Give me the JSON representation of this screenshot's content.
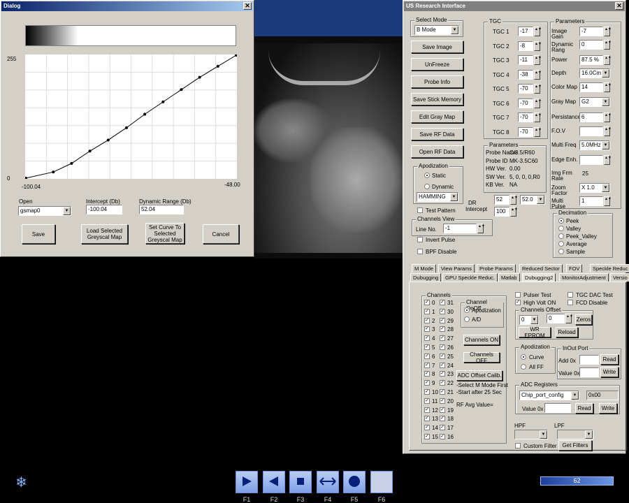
{
  "dialog": {
    "title": "Dialog",
    "close": "✕",
    "y_max": "255",
    "y_min": "0",
    "x_min": "-100.04",
    "x_max": "-48.00",
    "open_label": "Open",
    "open_value": "gsmap0",
    "intercept_label": "Intercept (Db)",
    "intercept_value": "-100.04",
    "range_label": "Dynamic Range (Db)",
    "range_value": "52.04",
    "btn_save": "Save",
    "btn_load": "Load Selected Greyscal Map",
    "btn_set": "Set Curve To Selected Greyscal Map",
    "btn_cancel": "Cancel",
    "curve": [
      [
        0,
        0
      ],
      [
        15,
        5
      ],
      [
        25,
        12
      ],
      [
        35,
        22
      ],
      [
        45,
        31
      ],
      [
        55,
        41
      ],
      [
        65,
        52
      ],
      [
        75,
        62
      ],
      [
        85,
        72
      ],
      [
        95,
        82
      ],
      [
        105,
        91
      ],
      [
        115,
        100
      ]
    ]
  },
  "us": {
    "title": "US Research Interface",
    "close": "✕",
    "select_mode_label": "Select Mode",
    "select_mode_value": "B Mode",
    "buttons": [
      "Save Image",
      "UnFreeze",
      "Probe Info",
      "Save Stick Memory",
      "Edit Gray Map",
      "Save RF Data",
      "Open RF Data"
    ],
    "tgc_label": "TGC",
    "tgc": [
      {
        "l": "TGC 1",
        "v": "-17"
      },
      {
        "l": "TGC 2",
        "v": "-8"
      },
      {
        "l": "TGC 3",
        "v": "-11"
      },
      {
        "l": "TGC 4",
        "v": "-38"
      },
      {
        "l": "TGC 5",
        "v": "-70"
      },
      {
        "l": "TGC 6",
        "v": "-70"
      },
      {
        "l": "TGC 7",
        "v": "-70"
      },
      {
        "l": "TGC 8",
        "v": "-70"
      }
    ],
    "params_label": "Parameters",
    "params": [
      {
        "l": "Image Gain",
        "v": "-7"
      },
      {
        "l": "Dynamic Rang",
        "v": "0"
      },
      {
        "l": "Power",
        "v": "87.5 %"
      },
      {
        "l": "Depth",
        "v": "16.0Cm"
      },
      {
        "l": "Color Map",
        "v": "14"
      },
      {
        "l": "Gray Map",
        "v": "G2"
      },
      {
        "l": "Persistance",
        "v": "6"
      },
      {
        "l": "F.O.V",
        "v": ""
      },
      {
        "l": "Multi Freq",
        "v": "5.0MHz"
      },
      {
        "l": "Edge Enh.",
        "v": ""
      },
      {
        "l": "Img Frm Rate",
        "v": "25"
      },
      {
        "l": "Zoom Factor",
        "v": "X 1.0"
      },
      {
        "l": "Multi Pulse",
        "v": "1"
      }
    ],
    "probe": {
      "label": "Parameters",
      "rows": [
        {
          "l": "Probe Name",
          "v": "C/3.5/R60"
        },
        {
          "l": "Probe ID",
          "v": "MK-3.5C60"
        },
        {
          "l": "HW Ver.",
          "v": "0.00"
        },
        {
          "l": "SW Ver.",
          "v": "5, 0, 0, 0,R0"
        },
        {
          "l": "KB Ver.",
          "v": "NA"
        }
      ]
    },
    "apod": {
      "label": "Apodization",
      "static": "Static",
      "dynamic": "Dynamic",
      "window": "HAMMING"
    },
    "test_pattern": "Test Pattern",
    "dr_label": "DR",
    "dr_value": "52",
    "dr_sel": "52.0",
    "intercept_label": "Intercept",
    "intercept_value": "100",
    "channels_view": {
      "label": "Channels View",
      "line_no": "Line No.",
      "line_val": "-1"
    },
    "invert": "Invert Pulse",
    "bpf": "BPF Disable",
    "decimation": {
      "label": "Decimation",
      "opts": [
        "Peek",
        "Valley",
        "Peek_Valley",
        "Average",
        "Sample"
      ]
    },
    "tabs_row1": [
      "M Mode",
      "View Params",
      "Probe Params",
      "Reduced Sector",
      "FOV",
      "Speckle Reduc"
    ],
    "tabs_row2": [
      "Dubugging",
      "GPU Speckle Reduc.",
      "Matlab",
      "Dubugging2",
      "MonitorAdjustment",
      "Versio"
    ],
    "channels_label": "Channels",
    "ch_left": [
      "0",
      "1",
      "2",
      "3",
      "4",
      "5",
      "6",
      "7",
      "8",
      "9",
      "10",
      "11",
      "12",
      "13",
      "14",
      "15"
    ],
    "ch_right": [
      "31",
      "30",
      "29",
      "28",
      "27",
      "26",
      "25",
      "24",
      "23",
      "22",
      "21",
      "20",
      "19",
      "18",
      "17",
      "16"
    ],
    "onoff": {
      "label": "Channel OnOff",
      "apod": "Apodization",
      "ad": "A/D"
    },
    "btn_on": "Channels ON",
    "btn_off": "Channels OFF",
    "btn_adc": "ADC Offset Calib.",
    "note1": "-Select M Mode First",
    "note2": "-Start after 25 Sec",
    "rf_avg": "RF Avg Value=",
    "pulser": "Pulser Test",
    "hv": "High Volt ON",
    "tgc_dac": "TGC DAC Test",
    "fcd": "FCD Disable",
    "offset": {
      "label": "Channels Offset",
      "v1": "0",
      "v2": "0",
      "zeros": "Zeros",
      "wr": "WR EPROM",
      "reload": "Reload"
    },
    "apod2": {
      "label": "Apodization",
      "curve": "Curve",
      "allff": "All FF"
    },
    "inout": {
      "label": "InOut Port",
      "add": "Add 0x",
      "value": "Value 0x",
      "read": "Read",
      "write": "Write"
    },
    "adc": {
      "label": "ADC Registers",
      "sel": "Chip_port_config",
      "hex": "0x00",
      "value": "Value 0x",
      "read": "Read",
      "write": "Write"
    },
    "hpf": "HPF",
    "lpf": "LPF",
    "custom": "Custom Filter",
    "get": "Get Filters"
  },
  "bottom": {
    "fkeys": [
      "F1",
      "F2",
      "F3",
      "F4",
      "F5",
      "F6"
    ],
    "progress": "62"
  }
}
